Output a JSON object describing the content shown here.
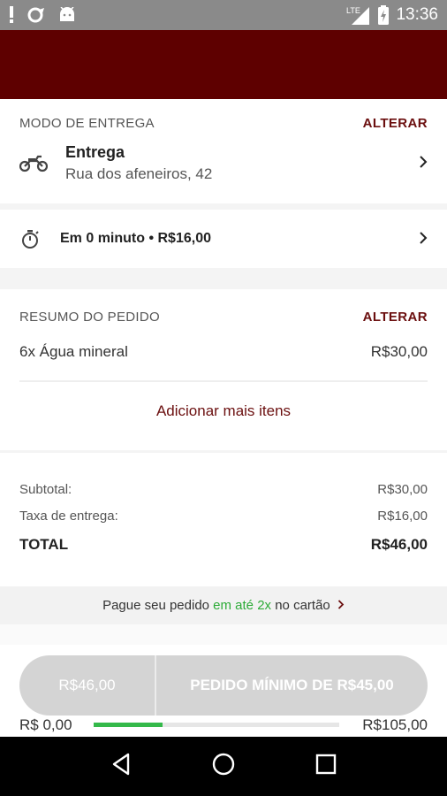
{
  "status_bar": {
    "time": "13:36",
    "network": "LTE",
    "icons": [
      "alert-icon",
      "sync-icon",
      "android-icon",
      "signal-icon",
      "battery-icon"
    ]
  },
  "delivery": {
    "section_title": "MODO DE ENTREGA",
    "alter_label": "ALTERAR",
    "mode_icon": "motorcycle-icon",
    "mode_label": "Entrega",
    "address": "Rua dos afeneiros, 42"
  },
  "timing": {
    "icon": "stopwatch-icon",
    "text": "Em 0 minuto • R$16,00"
  },
  "order_summary": {
    "section_title": "RESUMO DO PEDIDO",
    "alter_label": "ALTERAR",
    "items": [
      {
        "name": "6x Água mineral",
        "price": "R$30,00"
      }
    ],
    "add_more_label": "Adicionar mais itens"
  },
  "totals": {
    "subtotal_label": "Subtotal:",
    "subtotal_value": "R$30,00",
    "fee_label": "Taxa de entrega:",
    "fee_value": "R$16,00",
    "total_label": "TOTAL",
    "total_value": "R$46,00"
  },
  "promo": {
    "prefix": "Pague seu pedido",
    "highlight": "em até 2x",
    "suffix": "no cartão",
    "accent_color": "#2cab37"
  },
  "cta": {
    "total": "R$46,00",
    "label": "PEDIDO MÍNIMO DE R$45,00"
  },
  "minimum_progress": {
    "start_label": "R$ 0,00",
    "end_label": "R$105,00",
    "value": 0.28
  },
  "colors": {
    "brand": "#5e0000",
    "accent_text": "#6b0f0f"
  }
}
